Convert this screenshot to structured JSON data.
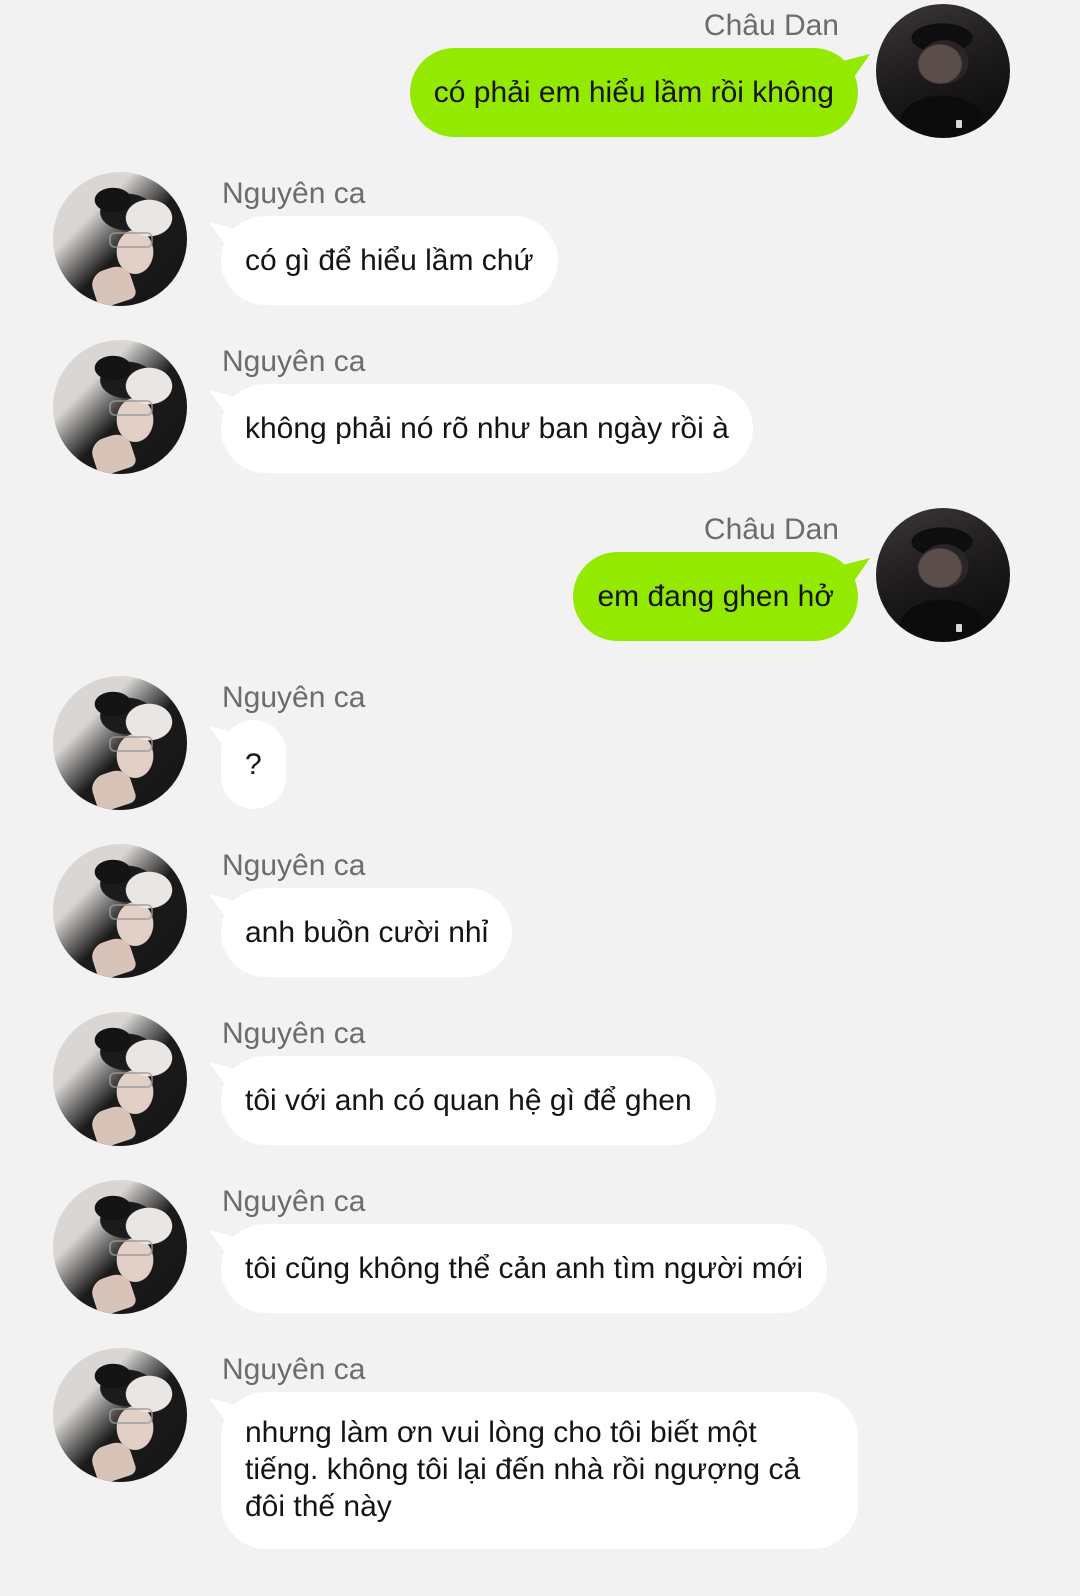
{
  "users": {
    "me": "Châu Dan",
    "other": "Nguyên ca"
  },
  "colors": {
    "background": "#f2f2f2",
    "sent_bubble": "#93ea00",
    "received_bubble": "#ffffff",
    "name_text": "#6c6c6c"
  },
  "messages": [
    {
      "sender": "Châu Dan",
      "direction": "sent",
      "text": "có phải em hiểu lầm rồi không"
    },
    {
      "sender": "Nguyên ca",
      "direction": "received",
      "text": "có gì để hiểu lầm chứ"
    },
    {
      "sender": "Nguyên ca",
      "direction": "received",
      "text": "không phải nó rõ như ban ngày rồi à"
    },
    {
      "sender": "Châu Dan",
      "direction": "sent",
      "text": "em đang ghen hở"
    },
    {
      "sender": "Nguyên ca",
      "direction": "received",
      "text": "?"
    },
    {
      "sender": "Nguyên ca",
      "direction": "received",
      "text": "anh buồn cười nhỉ"
    },
    {
      "sender": "Nguyên ca",
      "direction": "received",
      "text": "tôi với anh có quan hệ gì để ghen"
    },
    {
      "sender": "Nguyên ca",
      "direction": "received",
      "text": "tôi cũng không thể cản anh tìm người mới"
    },
    {
      "sender": "Nguyên ca",
      "direction": "received",
      "text": "nhưng làm ơn vui lòng cho tôi biết một tiếng. không tôi lại đến nhà rồi ngượng cả đôi thế này"
    }
  ]
}
